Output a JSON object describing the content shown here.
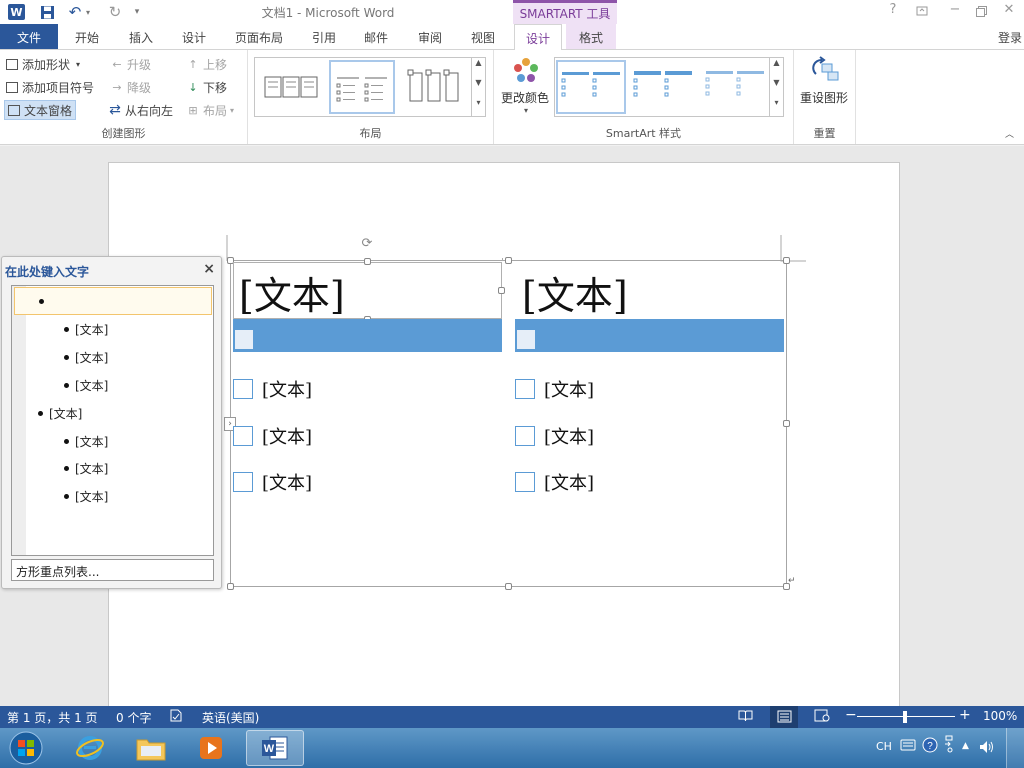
{
  "title_bar": {
    "app_badge": "W",
    "document_title": "文档1 - Microsoft Word",
    "context_tools_label": "SMARTART 工具",
    "help_glyph": "?"
  },
  "tabs": {
    "file": "文件",
    "home": "开始",
    "insert": "插入",
    "design": "设计",
    "page_layout": "页面布局",
    "references": "引用",
    "mailings": "邮件",
    "review": "审阅",
    "view": "视图",
    "sa_design": "设计",
    "sa_format": "格式",
    "login": "登录"
  },
  "ribbon": {
    "create_graphic": {
      "label": "创建图形",
      "add_shape": "添加形状",
      "add_bullet": "添加项目符号",
      "text_pane": "文本窗格",
      "promote": "升级",
      "demote": "降级",
      "right_to_left": "从右向左",
      "move_up": "上移",
      "move_down": "下移",
      "layout": "布局"
    },
    "layouts": {
      "label": "布局"
    },
    "styles": {
      "label": "SmartArt 样式",
      "change_colors": "更改颜色"
    },
    "reset": {
      "label": "重置",
      "reset_graphic": "重设图形"
    }
  },
  "text_pane": {
    "title": "在此处键入文字",
    "close_glyph": "×",
    "items": [
      {
        "level": 1,
        "text": ""
      },
      {
        "level": 2,
        "text": "[文本]"
      },
      {
        "level": 2,
        "text": "[文本]"
      },
      {
        "level": 2,
        "text": "[文本]"
      },
      {
        "level": 1,
        "text": "[文本]"
      },
      {
        "level": 2,
        "text": "[文本]"
      },
      {
        "level": 2,
        "text": "[文本]"
      },
      {
        "level": 2,
        "text": "[文本]"
      }
    ],
    "footer": "方形重点列表..."
  },
  "smartart": {
    "columns": [
      {
        "heading": "[文本]",
        "items": [
          "[文本]",
          "[文本]",
          "[文本]"
        ]
      },
      {
        "heading": "[文本]",
        "items": [
          "[文本]",
          "[文本]",
          "[文本]"
        ]
      }
    ],
    "accent_color": "#5b9bd5"
  },
  "status_bar": {
    "page": "第 1 页，共 1 页",
    "words": "0 个字",
    "language": "英语(美国)",
    "zoom": "100%"
  },
  "taskbar": {
    "tray_lang": "CH"
  },
  "colors": {
    "word_blue": "#2b579a",
    "smartart_purple": "#7a3c99"
  }
}
